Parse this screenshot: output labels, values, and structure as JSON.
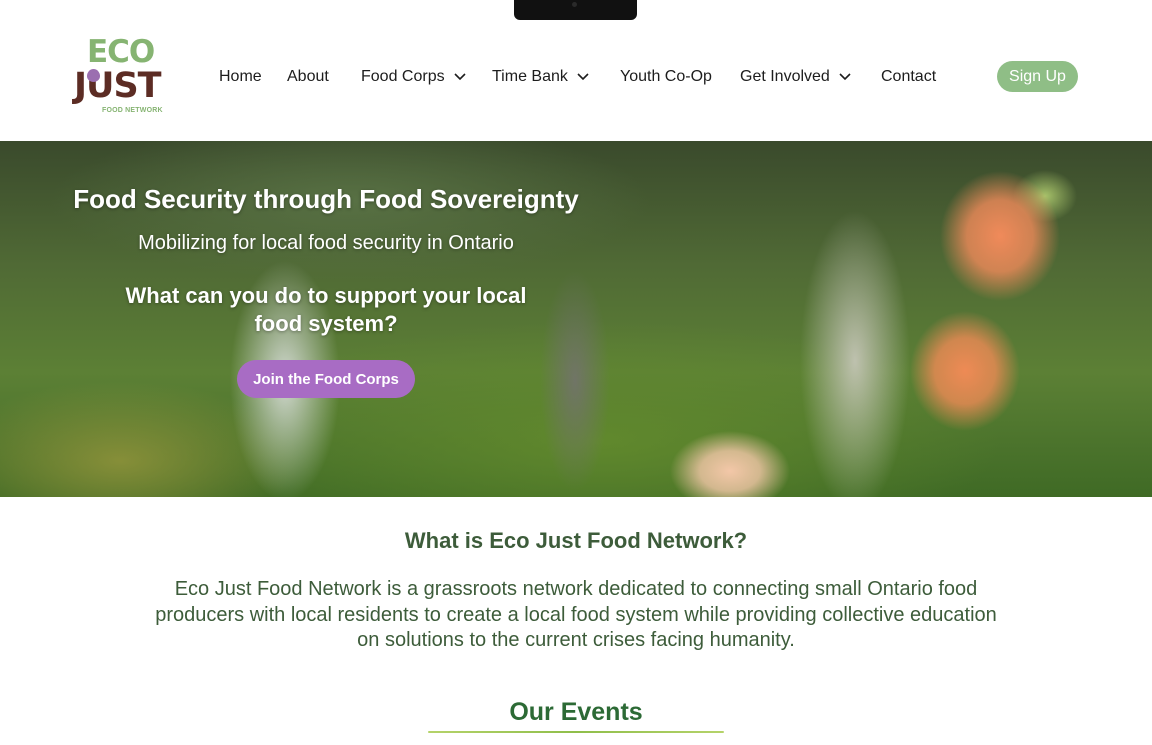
{
  "header": {
    "logo": {
      "line1": "ECO",
      "line2": "JUST",
      "line3": "FOOD NETWORK"
    },
    "nav": [
      {
        "label": "Home",
        "dropdown": false
      },
      {
        "label": "About",
        "dropdown": false
      },
      {
        "label": "Food Corps",
        "dropdown": true
      },
      {
        "label": "Time Bank",
        "dropdown": true
      },
      {
        "label": "Youth Co-Op",
        "dropdown": false
      },
      {
        "label": "Get Involved",
        "dropdown": true
      },
      {
        "label": "Contact",
        "dropdown": false
      }
    ],
    "signup_label": "Sign Up"
  },
  "hero": {
    "title": "Food Security through Food Sovereignty",
    "subtitle": "Mobilizing for local food security in Ontario",
    "question": "What can you do to support your local food system?",
    "button_label": "Join the Food Corps"
  },
  "about": {
    "title": "What is Eco Just Food Network?",
    "body": "Eco Just Food Network is a grassroots network dedicated to connecting small Ontario food producers with local residents to create a local food system while providing collective education on solutions to the current crises facing humanity."
  },
  "events": {
    "title": "Our Events"
  },
  "colors": {
    "brand_green": "#86b472",
    "brand_brown": "#5c2c24",
    "brand_purple": "#a86cc4",
    "text_green": "#3d5c3a",
    "heading_green": "#2c6a35",
    "signup_green": "#8fbe86"
  },
  "icons": {
    "dropdown": "chevron-down-icon"
  }
}
